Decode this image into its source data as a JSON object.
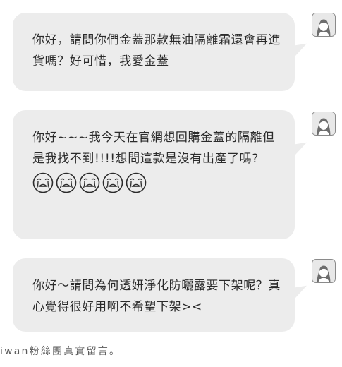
{
  "messages": [
    {
      "text": "你好，請問你們金蓋那款無油隔離霜還會再進貨嗎？好可惜，我愛金蓋"
    },
    {
      "text": "你好~~~我今天在官網想回購金蓋的隔離但是我找不到!!!!想問這款是沒有出產了嗎?",
      "emoji_count": 5,
      "emoji_icon": "crying-face-icon"
    },
    {
      "text": "你好～請問為何透妍淨化防曬露要下架呢？真心覺得很好用啊不希望下架><"
    }
  ],
  "footer": {
    "caption": "iwan粉絲團真實留言。"
  },
  "colors": {
    "bubble": "#ececec",
    "text": "#2b2b2b",
    "avatar_border": "#8a8a8a"
  },
  "icons": {
    "avatar": "user-avatar-icon"
  }
}
